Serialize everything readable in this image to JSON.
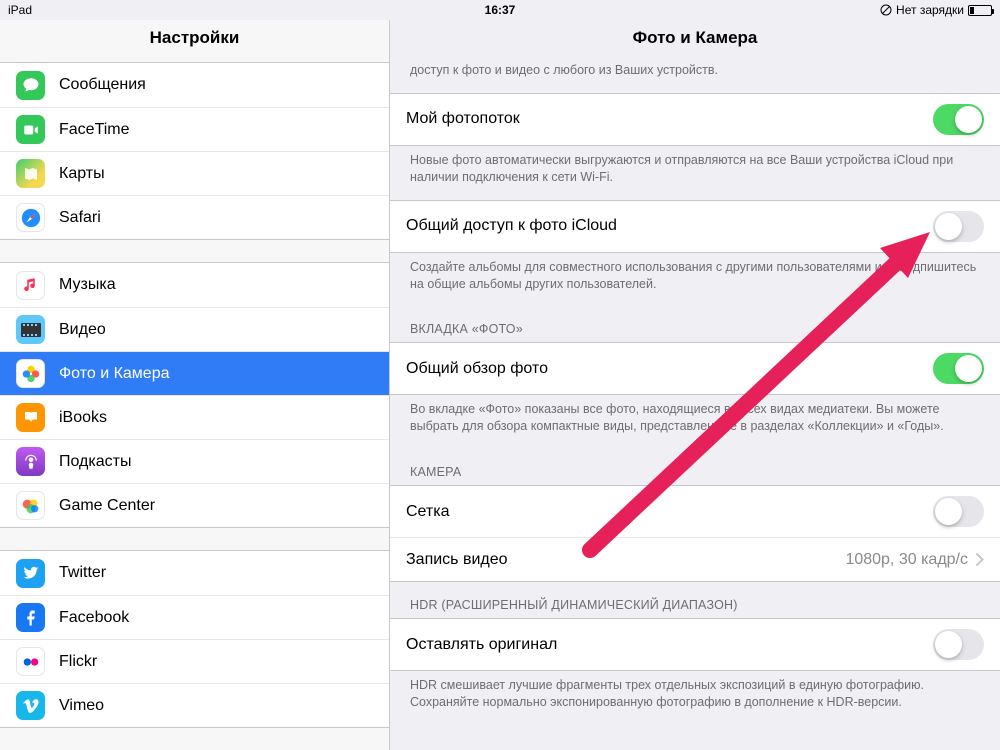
{
  "statusbar": {
    "device": "iPad",
    "time": "16:37",
    "charging_text": "Нет зарядки"
  },
  "sidebar": {
    "title": "Настройки",
    "group1": [
      {
        "label": "Сообщения"
      },
      {
        "label": "FaceTime"
      },
      {
        "label": "Карты"
      },
      {
        "label": "Safari"
      }
    ],
    "group2": [
      {
        "label": "Музыка"
      },
      {
        "label": "Видео"
      },
      {
        "label": "Фото и Камера",
        "selected": true
      },
      {
        "label": "iBooks"
      },
      {
        "label": "Подкасты"
      },
      {
        "label": "Game Center"
      }
    ],
    "group3": [
      {
        "label": "Twitter"
      },
      {
        "label": "Facebook"
      },
      {
        "label": "Flickr"
      },
      {
        "label": "Vimeo"
      }
    ]
  },
  "detail": {
    "title": "Фото и Камера",
    "icloud_hint_tail": "доступ к фото и видео с любого из Ваших устройств.",
    "photostream": {
      "label": "Мой фотопоток",
      "footer": "Новые фото автоматически выгружаются и отправляются на все Ваши устройства iCloud при наличии подключения к сети Wi-Fi.",
      "on": true
    },
    "sharing": {
      "label": "Общий доступ к фото iCloud",
      "footer": "Создайте альбомы для совместного использования с другими пользователями или подпишитесь на общие альбомы других пользователей.",
      "on": false
    },
    "tab_header": "Вкладка «Фото»",
    "summary": {
      "label": "Общий обзор фото",
      "footer": "Во вкладке «Фото» показаны все фото, находящиеся во всех видах медиатеки. Вы можете выбрать для обзора компактные виды, представленные в разделах «Коллекции» и «Годы».",
      "on": true
    },
    "camera_header": "Камера",
    "grid": {
      "label": "Сетка",
      "on": false
    },
    "record": {
      "label": "Запись видео",
      "value": "1080p, 30 кадр/с"
    },
    "hdr_header": "HDR (расширенный динамический диапазон)",
    "hdr": {
      "label": "Оставлять оригинал",
      "footer": "HDR смешивает лучшие фрагменты трех отдельных экспозиций в единую фотографию. Сохраняйте нормально экспонированную фотографию в дополнение к HDR-версии.",
      "on": false
    }
  }
}
